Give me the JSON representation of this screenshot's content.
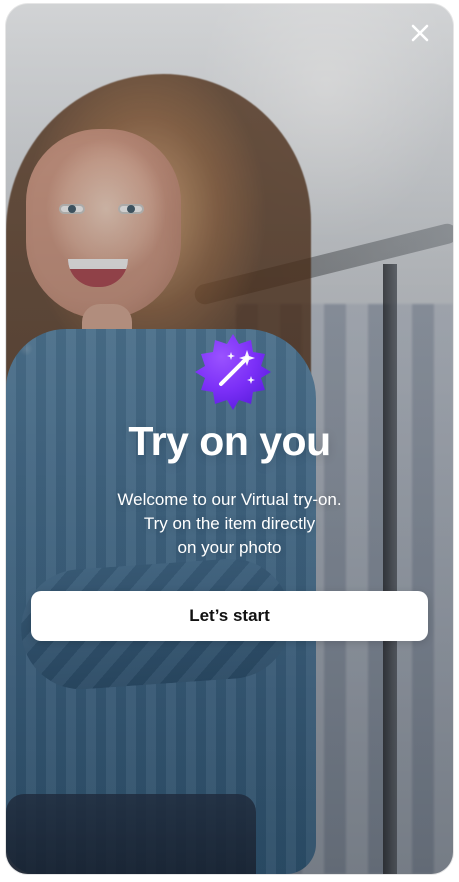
{
  "modal": {
    "title": "Try on you",
    "subtitle_lines": [
      "Welcome to our Virtual try-on.",
      "Try on the item directly",
      "on your photo"
    ],
    "cta_label": "Let’s start",
    "icons": {
      "close": "close-icon",
      "badge": "sparkles-badge-icon"
    },
    "colors": {
      "badge_purple": "#7B2FF7",
      "badge_purple_dark": "#5E1FE0",
      "white": "#FFFFFF"
    }
  }
}
